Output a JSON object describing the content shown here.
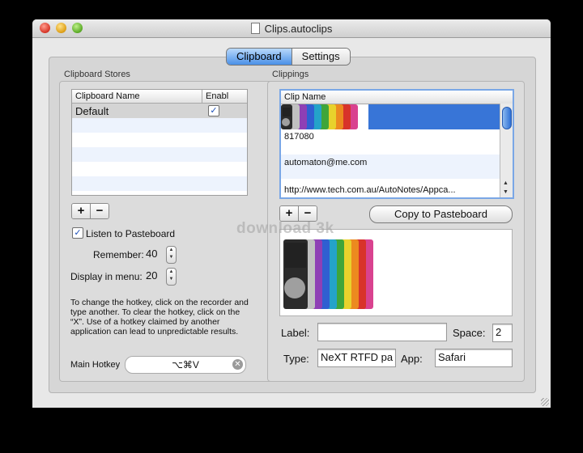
{
  "window": {
    "title": "Clips.autoclips"
  },
  "tabs": [
    {
      "label": "Clipboard",
      "active": true
    },
    {
      "label": "Settings",
      "active": false
    }
  ],
  "stores": {
    "group_label": "Clipboard Stores",
    "columns": [
      "Clipboard Name",
      "Enabl"
    ],
    "rows": [
      {
        "name": "Default",
        "enabled": true
      }
    ],
    "add_label": "+",
    "remove_label": "−",
    "listen_label": "Listen to Pasteboard",
    "listen_checked": true,
    "remember_label": "Remember:",
    "remember_value": "40",
    "display_label": "Display in menu:",
    "display_value": "20",
    "hotkey_help": "To change the hotkey, click on the recorder and type another. To clear the hotkey, click on the “X”. Use of a hotkey claimed by another application can lead to unpredictable results.",
    "hotkey_label": "Main Hotkey",
    "hotkey_value": "⌥⌘V"
  },
  "clippings": {
    "group_label": "Clippings",
    "column": "Clip Name",
    "items": [
      "817080",
      "automaton@me.com",
      "http://www.tech.com.au/AutoNotes/Appca..."
    ],
    "add_label": "+",
    "remove_label": "−",
    "copy_label": "Copy to Pasteboard",
    "label_label": "Label:",
    "label_value": "",
    "space_label": "Space:",
    "space_value": "2",
    "type_label": "Type:",
    "type_value": "NeXT RTFD pa",
    "app_label": "App:",
    "app_value": "Safari"
  },
  "watermark": "download 3k",
  "colors": {
    "selection": "#3875d7",
    "accent": "#4a90e8"
  },
  "ipod_colors": [
    "#2b2b2b",
    "#c0c0c0",
    "#8e3fb5",
    "#2f5fd1",
    "#24a3c9",
    "#3fa53a",
    "#e8d22c",
    "#ec8a1f",
    "#d8332a",
    "#d9428f"
  ]
}
